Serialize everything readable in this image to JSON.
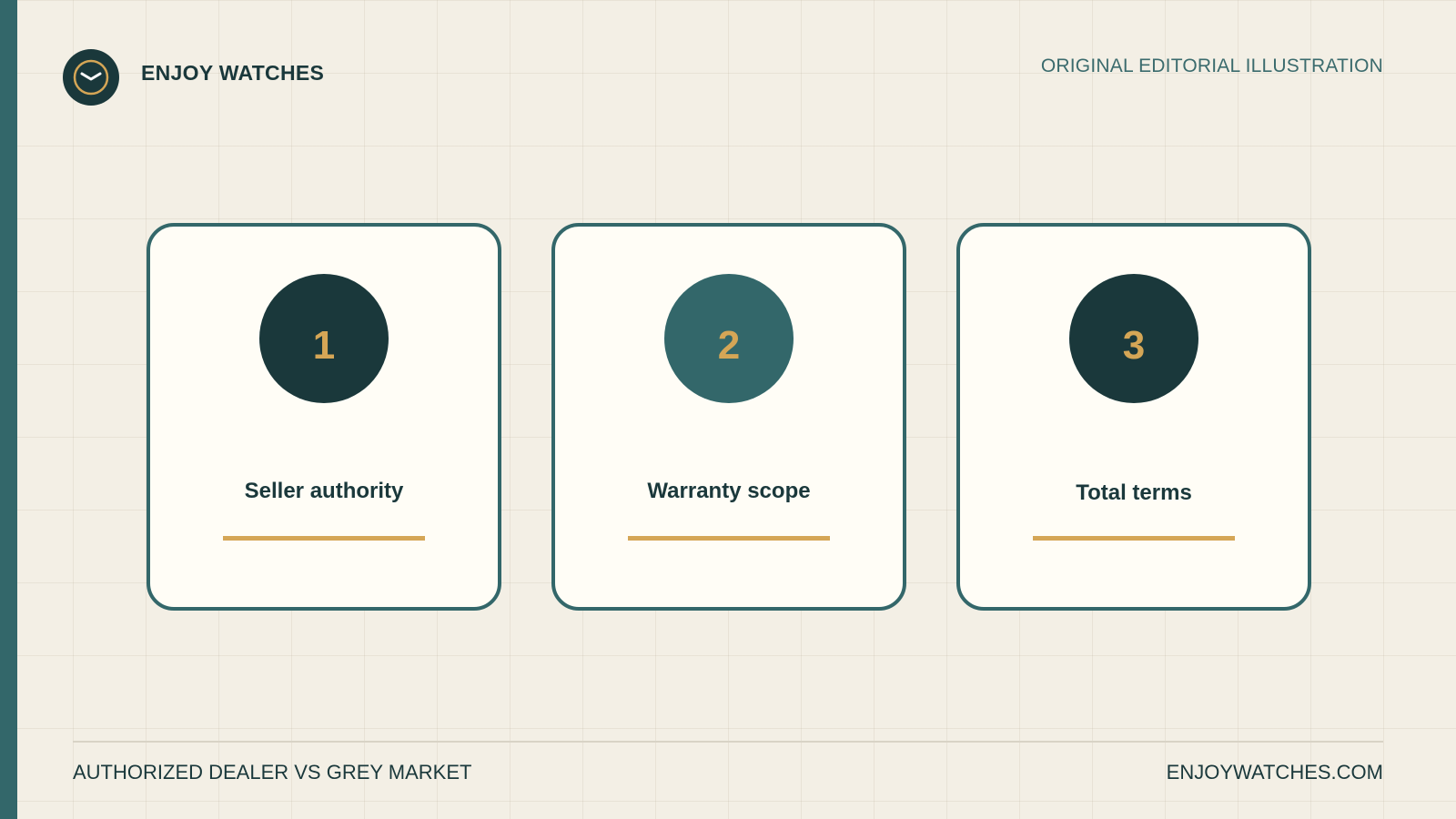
{
  "brand": {
    "name": "ENJOY WATCHES",
    "logo_icon": "watch-icon"
  },
  "tagline": "ORIGINAL EDITORIAL ILLUSTRATION",
  "cards": [
    {
      "number": "1",
      "label": "Seller authority",
      "circle_color": "#1a383b"
    },
    {
      "number": "2",
      "label": "Warranty scope",
      "circle_color": "#33676a"
    },
    {
      "number": "3",
      "label": "Total terms",
      "circle_color": "#1a383b"
    }
  ],
  "footer": {
    "title": "AUTHORIZED DEALER VS GREY MARKET",
    "site": "ENJOYWATCHES.COM"
  },
  "colors": {
    "background": "#f3efe5",
    "accent_gold": "#d5a656",
    "teal": "#33676a",
    "dark_teal": "#1a383b",
    "card_background": "#fffdf6"
  }
}
